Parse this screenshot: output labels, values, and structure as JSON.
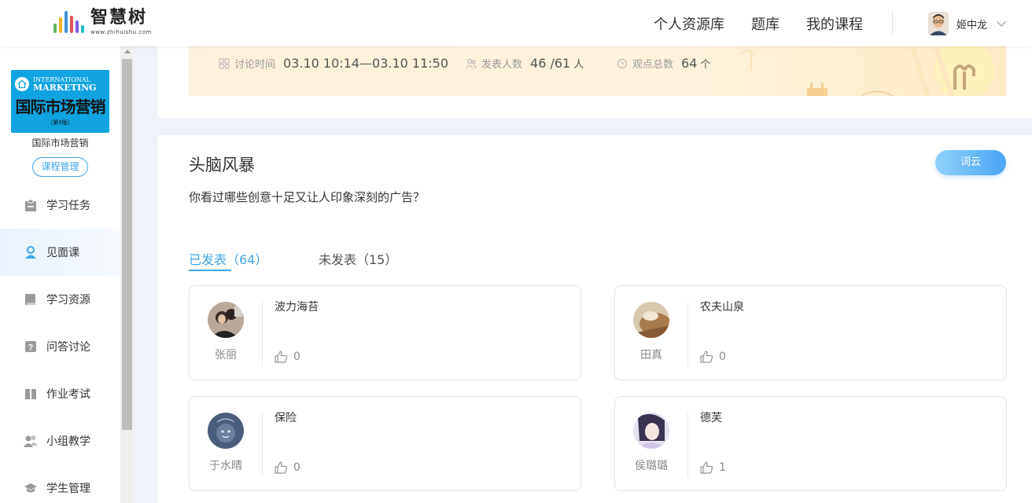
{
  "brand": {
    "name": "智慧树",
    "url": "www.zhihuishu.com",
    "colors": [
      "#5fb35f",
      "#f0b429",
      "#3b8fe0",
      "#e55353",
      "#7c5ee0",
      "#22b8cf",
      "#f08c2e"
    ]
  },
  "nav": {
    "items": [
      "个人资源库",
      "题库",
      "我的课程"
    ],
    "username": "姬中龙"
  },
  "sidebar": {
    "book": {
      "en_line1": "INTERNATIONAL",
      "en_line2": "MARKETING",
      "cn_title": "国际市场营销",
      "edition": "（第5版）"
    },
    "course_name": "国际市场营销",
    "manage_label": "课程管理",
    "items": [
      {
        "label": "学习任务",
        "icon": "clipboard-icon"
      },
      {
        "label": "见面课",
        "icon": "person-icon"
      },
      {
        "label": "学习资源",
        "icon": "book-icon"
      },
      {
        "label": "问答讨论",
        "icon": "question-icon"
      },
      {
        "label": "作业考试",
        "icon": "exam-icon"
      },
      {
        "label": "小组教学",
        "icon": "group-icon"
      },
      {
        "label": "学生管理",
        "icon": "graduation-cap-icon"
      }
    ],
    "active_index": 1
  },
  "banner": {
    "time_label": "讨论时间",
    "time_value": "03.10 10:14—03.10 11:50",
    "people_label": "发表人数",
    "people_value": "46 /61",
    "people_unit": "人",
    "views_label": "观点总数",
    "views_value": "64",
    "views_unit": "个"
  },
  "activity": {
    "title": "头脑风暴",
    "question": "你看过哪些创意十足又让人印象深刻的广告？",
    "wordcloud_label": "词云",
    "tabs": {
      "published": "已发表（64）",
      "unpublished": "未发表（15）"
    }
  },
  "replies": [
    {
      "name": "张丽",
      "text": "波力海苔",
      "likes": "0"
    },
    {
      "name": "田真",
      "text": "农夫山泉",
      "likes": "0"
    },
    {
      "name": "于水晴",
      "text": "保险",
      "likes": "0"
    },
    {
      "name": "侯璐璐",
      "text": "德芙",
      "likes": "1"
    }
  ],
  "accent_color": "#3fa6ea"
}
